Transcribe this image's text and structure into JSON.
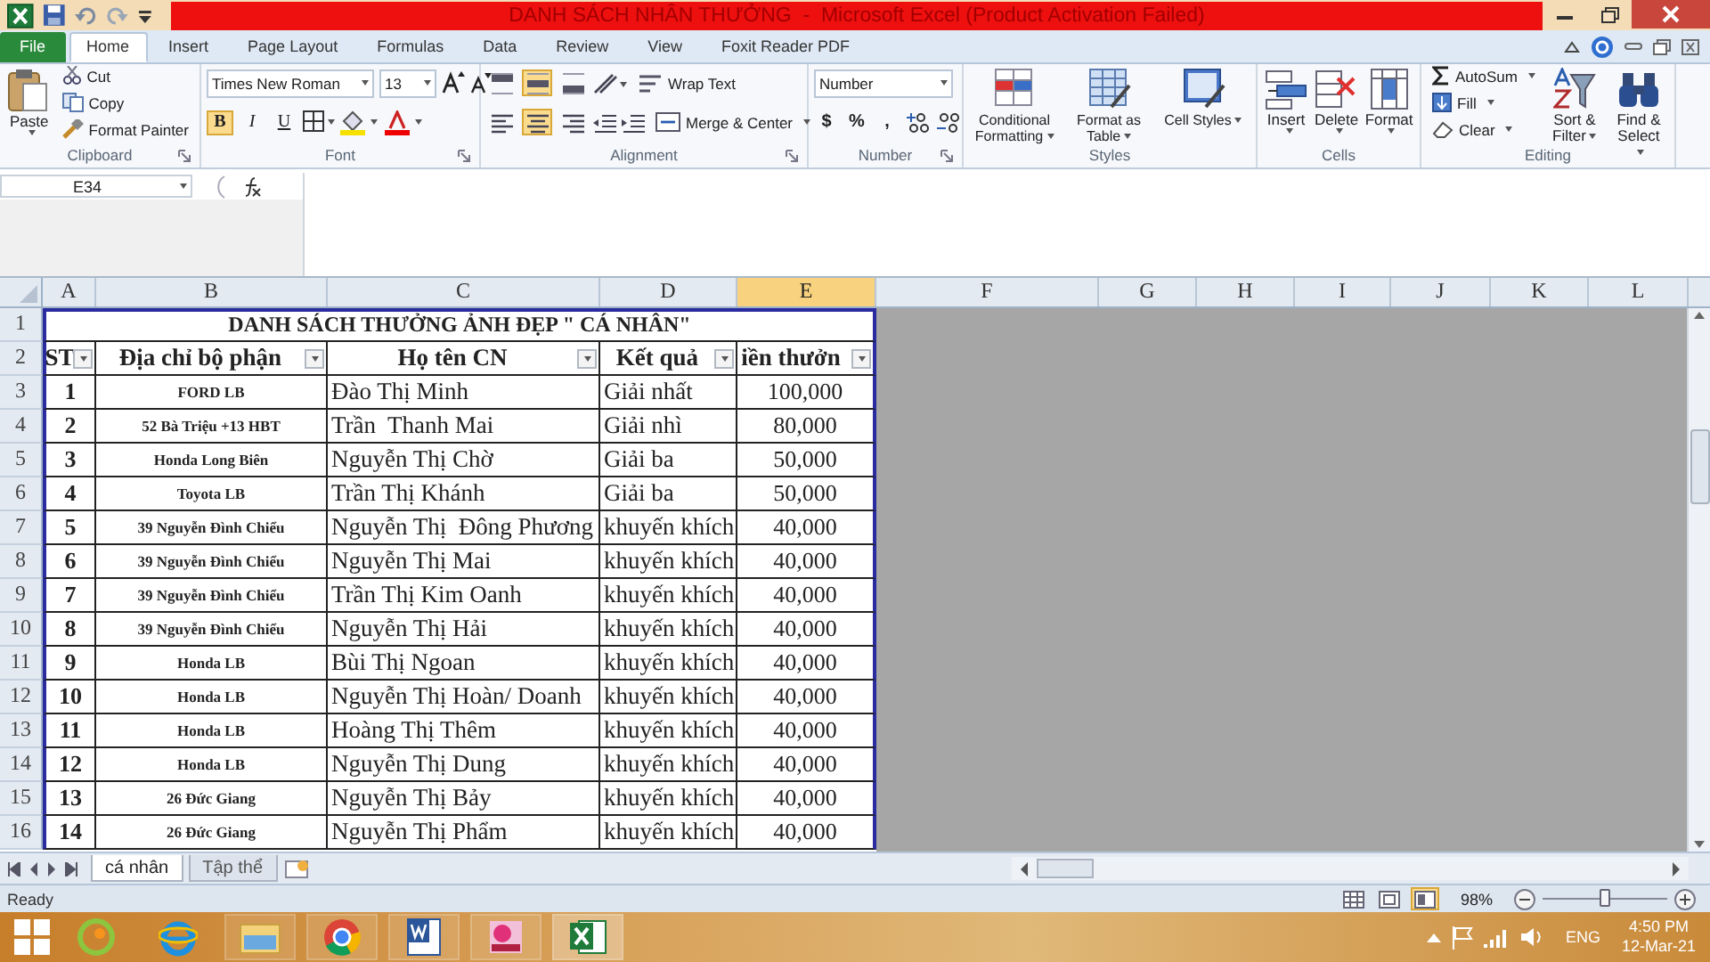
{
  "title_bar": {
    "title": "DANH SÁCH NHÂN THƯỞNG  -  Microsoft Excel (Product Activation Failed)"
  },
  "tabs": [
    {
      "label": "File",
      "kind": "file",
      "selected": false
    },
    {
      "label": "Home",
      "kind": "tab",
      "selected": true
    },
    {
      "label": "Insert",
      "kind": "tab",
      "selected": false
    },
    {
      "label": "Page Layout",
      "kind": "tab",
      "selected": false
    },
    {
      "label": "Formulas",
      "kind": "tab",
      "selected": false
    },
    {
      "label": "Data",
      "kind": "tab",
      "selected": false
    },
    {
      "label": "Review",
      "kind": "tab",
      "selected": false
    },
    {
      "label": "View",
      "kind": "tab",
      "selected": false
    },
    {
      "label": "Foxit Reader PDF",
      "kind": "tab",
      "selected": false
    }
  ],
  "ribbon": {
    "groups": [
      {
        "kind": "clipboard",
        "label": "Clipboard",
        "paste": "Paste",
        "items": [
          "Cut",
          "Copy",
          "Format Painter"
        ]
      },
      {
        "kind": "font",
        "label": "Font",
        "font_name": "Times New Roman",
        "font_size": "13",
        "toggles": [
          {
            "label": "B",
            "selected": true
          },
          {
            "label": "I",
            "selected": false
          },
          {
            "label": "U",
            "selected": false
          }
        ]
      },
      {
        "kind": "alignment",
        "label": "Alignment",
        "vertical": [
          {
            "selected": false
          },
          {
            "selected": true
          },
          {
            "selected": false
          }
        ],
        "horizontal": [
          {
            "selected": false
          },
          {
            "selected": true
          },
          {
            "selected": false
          }
        ],
        "buttons": [
          "Wrap Text",
          "Merge & Center"
        ]
      },
      {
        "kind": "number",
        "label": "Number",
        "format": "Number",
        "symbols": [
          "$",
          "%",
          ","
        ]
      },
      {
        "kind": "styles",
        "label": "Styles",
        "buttons": [
          "Conditional Formatting",
          "Format as Table",
          "Cell Styles"
        ]
      },
      {
        "kind": "cells",
        "label": "Cells",
        "buttons": [
          "Insert",
          "Delete",
          "Format"
        ]
      },
      {
        "kind": "editing",
        "label": "Editing",
        "small": [
          "AutoSum",
          "Fill",
          "Clear"
        ],
        "large": [
          "Sort & Filter",
          "Find & Select"
        ]
      }
    ]
  },
  "formula_bar": {
    "name_box": "E34"
  },
  "sheet": {
    "columns": [
      {
        "label": "A",
        "selected": false
      },
      {
        "label": "B",
        "selected": false
      },
      {
        "label": "C",
        "selected": false
      },
      {
        "label": "D",
        "selected": false
      },
      {
        "label": "E",
        "selected": true
      },
      {
        "label": "F",
        "selected": false
      },
      {
        "label": "G",
        "selected": false
      },
      {
        "label": "H",
        "selected": false
      },
      {
        "label": "I",
        "selected": false
      },
      {
        "label": "J",
        "selected": false
      },
      {
        "label": "K",
        "selected": false
      },
      {
        "label": "L",
        "selected": false
      }
    ],
    "title_row": {
      "row_number": "1",
      "text": "DANH SÁCH THƯỞNG ẢNH ĐẸP \" CÁ NHÂN\""
    },
    "header_row": {
      "row_number": "2",
      "labels": [
        "ST",
        "Địa chỉ bộ phận",
        "Họ tên CN",
        "Kết quả",
        "iền thưởn"
      ]
    },
    "rows": [
      {
        "row_number": "3",
        "cells": [
          "1",
          "FORD LB",
          "Đào Thị Minh",
          "Giải nhất",
          "100,000"
        ]
      },
      {
        "row_number": "4",
        "cells": [
          "2",
          "52 Bà Triệu +13 HBT",
          "Trần  Thanh Mai",
          "Giải nhì",
          "80,000"
        ]
      },
      {
        "row_number": "5",
        "cells": [
          "3",
          "Honda Long Biên",
          "Nguyễn Thị Chờ",
          "Giải ba",
          "50,000"
        ]
      },
      {
        "row_number": "6",
        "cells": [
          "4",
          "Toyota LB",
          "Trần Thị Khánh",
          "Giải ba",
          "50,000"
        ]
      },
      {
        "row_number": "7",
        "cells": [
          "5",
          "39 Nguyễn Đình Chiểu",
          "Nguyễn Thị  Đông Phương",
          "khuyến khích",
          "40,000"
        ]
      },
      {
        "row_number": "8",
        "cells": [
          "6",
          "39 Nguyễn Đình Chiểu",
          "Nguyễn Thị Mai",
          "khuyến khích",
          "40,000"
        ]
      },
      {
        "row_number": "9",
        "cells": [
          "7",
          "39 Nguyễn Đình Chiểu",
          "Trần Thị Kim Oanh",
          "khuyến khích",
          "40,000"
        ]
      },
      {
        "row_number": "10",
        "cells": [
          "8",
          "39 Nguyễn Đình Chiểu",
          "Nguyễn Thị Hải",
          "khuyến khích",
          "40,000"
        ]
      },
      {
        "row_number": "11",
        "cells": [
          "9",
          "Honda LB",
          "Bùi Thị Ngoan",
          "khuyến khích",
          "40,000"
        ]
      },
      {
        "row_number": "12",
        "cells": [
          "10",
          "Honda LB",
          "Nguyễn Thị Hoàn/ Doanh",
          "khuyến khích",
          "40,000"
        ]
      },
      {
        "row_number": "13",
        "cells": [
          "11",
          "Honda LB",
          "Hoàng Thị Thêm",
          "khuyến khích",
          "40,000"
        ]
      },
      {
        "row_number": "14",
        "cells": [
          "12",
          "Honda LB",
          "Nguyễn Thị Dung",
          "khuyến khích",
          "40,000"
        ]
      },
      {
        "row_number": "15",
        "cells": [
          "13",
          "26 Đức Giang",
          "Nguyễn Thị Bảy",
          "khuyến khích",
          "40,000"
        ]
      },
      {
        "row_number": "16",
        "cells": [
          "14",
          "26 Đức Giang",
          "Nguyễn Thị Phẩm",
          "khuyến khích",
          "40,000"
        ]
      }
    ]
  },
  "sheet_tabs": [
    {
      "label": "cá nhân",
      "selected": true
    },
    {
      "label": "Tập thể",
      "selected": false
    }
  ],
  "status_bar": {
    "status": "Ready",
    "views": [
      {
        "kind": "normal",
        "selected": false
      },
      {
        "kind": "page_layout",
        "selected": false
      },
      {
        "kind": "page_break",
        "selected": true
      }
    ],
    "zoom": "98%",
    "zoom_slider": {
      "level": 0.5
    }
  },
  "taskbar": {
    "language": "ENG",
    "time": "4:50 PM",
    "date": "12-Mar-21"
  }
}
